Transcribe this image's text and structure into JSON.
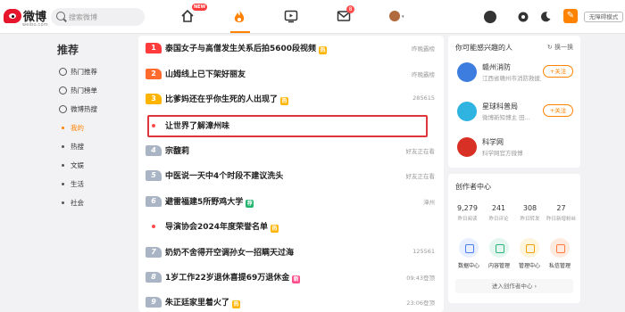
{
  "header": {
    "logo_text": "微博",
    "logo_sub": "weibo.com",
    "search_placeholder": "搜索微博",
    "new_badge": "NEW",
    "mail_count": "8",
    "accessibility_label": "无障碍模式"
  },
  "sidebar": {
    "title": "推荐",
    "items": [
      {
        "label": "热门推荐",
        "icon": "fire-circle-icon"
      },
      {
        "label": "热门榜单",
        "icon": "clock-icon"
      },
      {
        "label": "微博热搜",
        "icon": "search-circle-icon"
      },
      {
        "label": "我的",
        "active": true
      },
      {
        "label": "热搜"
      },
      {
        "label": "文娱"
      },
      {
        "label": "生活"
      },
      {
        "label": "社会"
      }
    ]
  },
  "hot_list": [
    {
      "rank": "1",
      "title": "泰国女子与高僧发生关系后拍5600段视频",
      "tag": "热",
      "meta": "昨晚霸榜"
    },
    {
      "rank": "2",
      "title": "山姆线上已下架好丽友",
      "tag": "",
      "meta": "昨晚霸榜"
    },
    {
      "rank": "3",
      "title": "比爹妈还在乎你生死的人出现了",
      "tag": "热",
      "meta": "285615"
    },
    {
      "rank": "",
      "title": "让世界了解漳州味",
      "tag": "",
      "meta": ""
    },
    {
      "rank": "4",
      "title": "宗馥莉",
      "tag": "",
      "meta": "好友正在看"
    },
    {
      "rank": "5",
      "title": "中医说一天中4个时段不建议洗头",
      "tag": "",
      "meta": "好友正在看"
    },
    {
      "rank": "6",
      "title": "避雷福建5所野鸡大学",
      "tag": "荐",
      "meta": "漳州"
    },
    {
      "rank": "",
      "title": "导演协会2024年度荣誉名单",
      "tag": "热",
      "meta": ""
    },
    {
      "rank": "7",
      "title": "奶奶不舍得开空调孙女一招瞒天过海",
      "tag": "",
      "meta": "125561"
    },
    {
      "rank": "8",
      "title": "1岁工作22岁退休喜提69万退休金",
      "tag": "新",
      "meta": "09:43登顶"
    },
    {
      "rank": "9",
      "title": "朱正廷家里着火了",
      "tag": "热",
      "meta": "23:06登顶"
    }
  ],
  "recommend": {
    "title": "你可能感兴趣的人",
    "refresh": "换一换",
    "follow_label": "+关注",
    "users": [
      {
        "name": "赣州消防",
        "desc": "江西省赣州市消防救援支队",
        "color": "#3d7de0"
      },
      {
        "name": "星球科普局",
        "desc": "微博新知博主 田...",
        "color": "#2fb3e0"
      },
      {
        "name": "科学网",
        "desc": "科学网官方微博",
        "color": "#d93025"
      }
    ]
  },
  "creator": {
    "title": "创作者中心",
    "stats": [
      {
        "value": "9,279",
        "label": "昨日阅读"
      },
      {
        "value": "241",
        "label": "昨日评论"
      },
      {
        "value": "308",
        "label": "昨日转发"
      },
      {
        "value": "27",
        "label": "昨日新增粉丝"
      }
    ],
    "tools": [
      {
        "label": "数据中心",
        "bg": "#e8efff",
        "color": "#4a7cf5"
      },
      {
        "label": "内容管理",
        "bg": "#e3f6ef",
        "color": "#2bb37a"
      },
      {
        "label": "管理中心",
        "bg": "#fff4dc",
        "color": "#f2a200"
      },
      {
        "label": "私信管理",
        "bg": "#ffeadf",
        "color": "#ff7a3d"
      }
    ],
    "enter_label": "进入创作者中心"
  }
}
